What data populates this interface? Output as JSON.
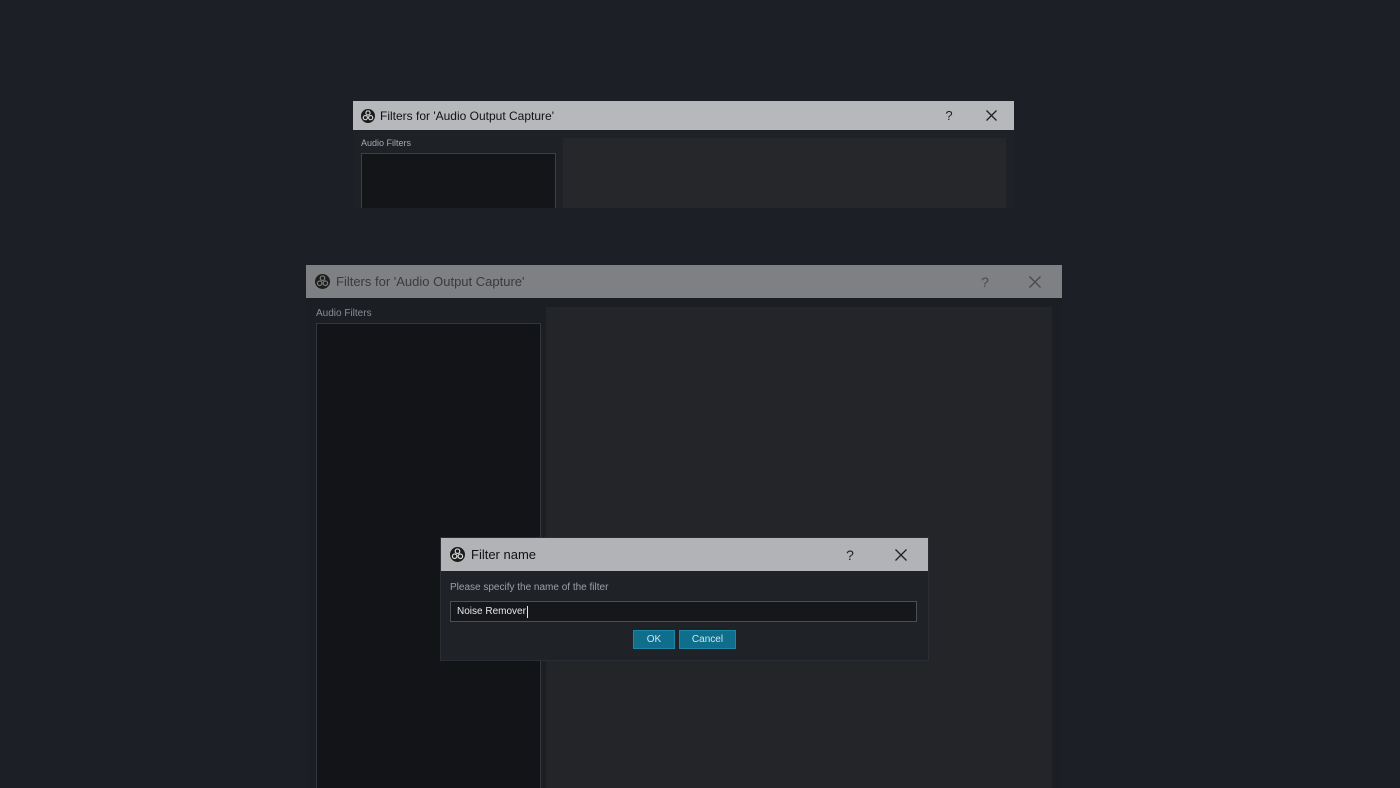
{
  "top_window": {
    "title": "Filters for 'Audio Output Capture'",
    "help_label": "?",
    "audio_filters_label": "Audio Filters"
  },
  "main_window": {
    "title": "Filters for 'Audio Output Capture'",
    "help_label": "?",
    "audio_filters_label": "Audio Filters"
  },
  "dialog": {
    "title": "Filter name",
    "help_label": "?",
    "prompt": "Please specify the name of the filter",
    "input_value": "Noise Remover",
    "ok_label": "OK",
    "cancel_label": "Cancel"
  },
  "icons": {
    "app": "obs-logo-icon",
    "close": "close-icon",
    "help": "help-icon"
  },
  "colors": {
    "background": "#1c1f25",
    "titlebar": "#b6b8bc",
    "accent_button": "#0f6e8c"
  }
}
